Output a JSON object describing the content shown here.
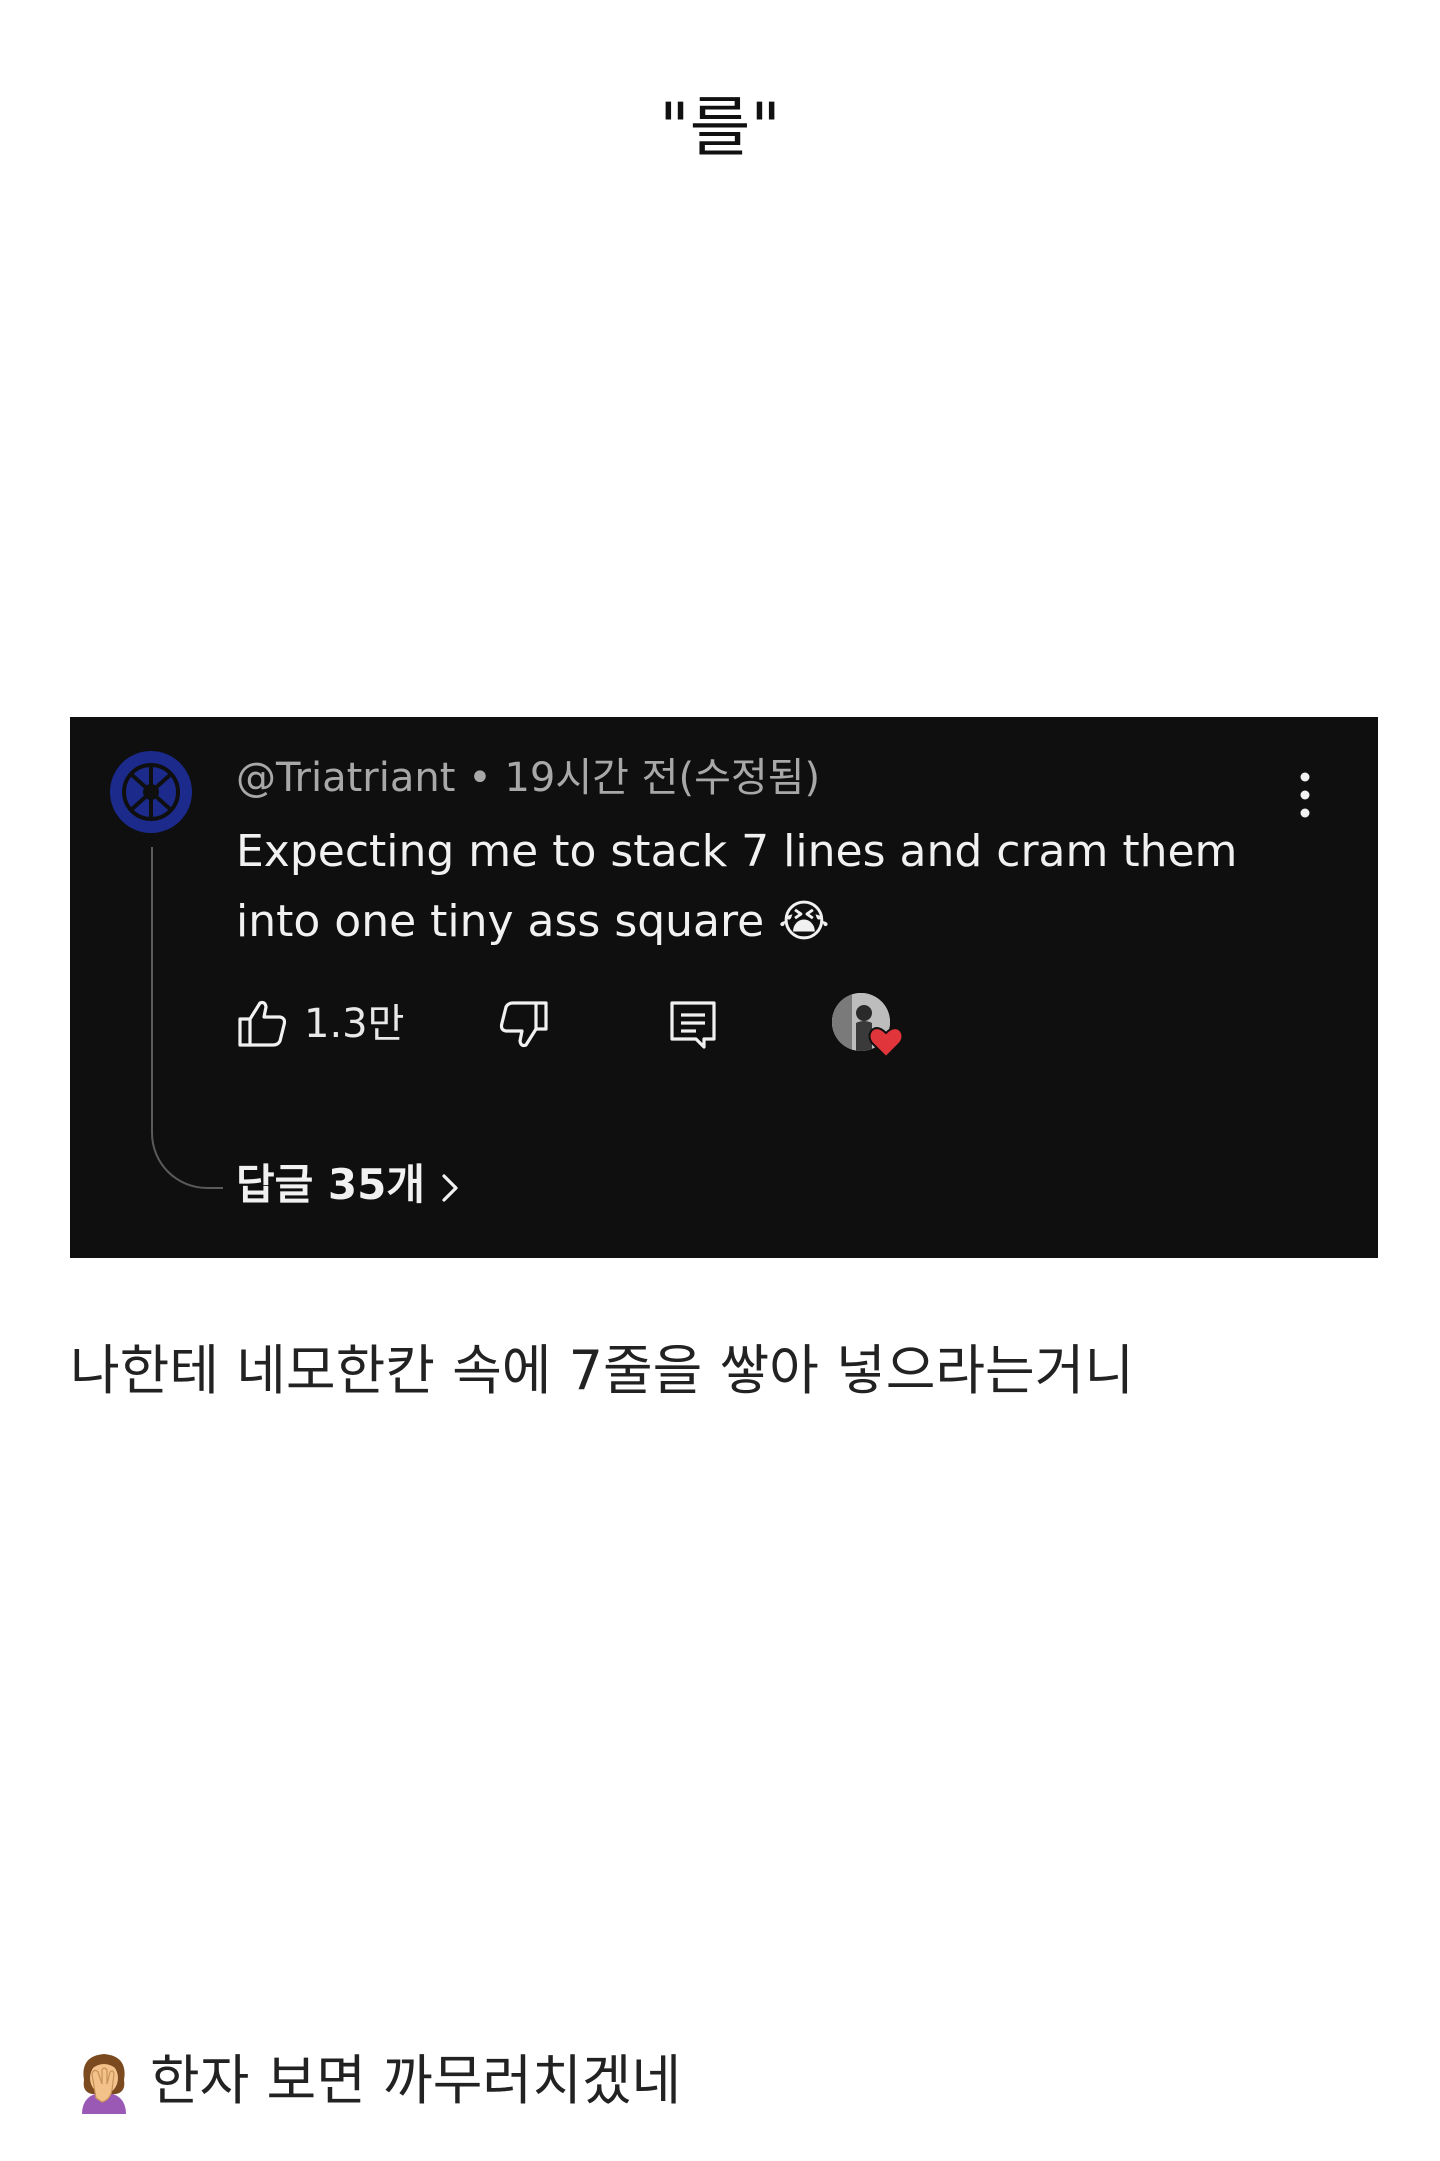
{
  "page": {
    "title": "\"를\""
  },
  "comment": {
    "username": "@Triatriant",
    "separator": " • ",
    "time": "19시간 전(수정됨)",
    "text": "Expecting me to stack 7 lines and cram them into one tiny ass square 😭",
    "like_count": "1.3만",
    "replies_label": "답글 35개",
    "icons": {
      "menu": "more-vert-icon",
      "like": "thumb-up-icon",
      "dislike": "thumb-down-icon",
      "reply": "comment-icon",
      "creator_heart": "heart-icon",
      "replies_chevron": "chevron-right-icon"
    },
    "colors": {
      "card_background": "#0f0f0f",
      "avatar": "#1c2a8c",
      "heart": "#e0353b"
    }
  },
  "caption": {
    "text": "나한테 네모한칸 속에 7줄을 쌓아 넣으라는거니"
  },
  "footer": {
    "text": "한자 보면 까무러치겠네",
    "icon": "facepalm-emoji"
  }
}
